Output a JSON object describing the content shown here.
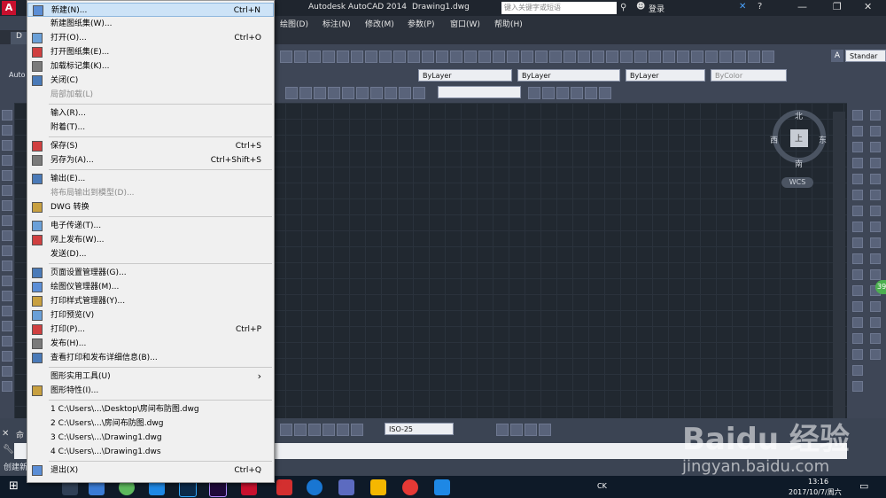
{
  "app": {
    "app_title": "Autodesk AutoCAD 2014",
    "document_title": "Drawing1.dwg",
    "search_placeholder": "键入关键字或短语",
    "login_label": "登录",
    "tab_label": "D",
    "ribbon_label": "Auto",
    "standard_label": "Standar"
  },
  "menubar": [
    "绘图(D)",
    "标注(N)",
    "修改(M)",
    "参数(P)",
    "窗口(W)",
    "帮助(H)"
  ],
  "properties": {
    "color": "ByLayer",
    "linetype": "ByLayer",
    "lineweight": "ByLayer",
    "plotstyle": "ByColor",
    "dimstyle": "ISO-25"
  },
  "viewcube": {
    "north": "北",
    "south": "南",
    "east": "东",
    "west": "西",
    "face": "上",
    "wcs": "WCS"
  },
  "file_menu": {
    "items": [
      {
        "label": "新建(N)...",
        "shortcut": "Ctrl+N",
        "icon": "new-file-icon",
        "highlighted": true
      },
      {
        "label": "新建图纸集(W)...",
        "shortcut": "",
        "icon": ""
      },
      {
        "label": "打开(O)...",
        "shortcut": "Ctrl+O",
        "icon": "open-folder-icon"
      },
      {
        "label": "打开图纸集(E)...",
        "shortcut": "",
        "icon": "sheet-set-icon"
      },
      {
        "label": "加载标记集(K)...",
        "shortcut": "",
        "icon": "markup-icon"
      },
      {
        "label": "关闭(C)",
        "shortcut": "",
        "icon": "close-doc-icon"
      },
      {
        "label": "局部加载(L)",
        "shortcut": "",
        "icon": "",
        "disabled": true
      },
      {
        "label": "输入(R)...",
        "shortcut": "",
        "icon": ""
      },
      {
        "label": "附着(T)...",
        "shortcut": "",
        "icon": ""
      },
      {
        "label": "保存(S)",
        "shortcut": "Ctrl+S",
        "icon": "save-icon"
      },
      {
        "label": "另存为(A)...",
        "shortcut": "Ctrl+Shift+S",
        "icon": "save-as-icon"
      },
      {
        "label": "输出(E)...",
        "shortcut": "",
        "icon": "export-icon"
      },
      {
        "label": "将布局输出到模型(D)...",
        "shortcut": "",
        "icon": "",
        "disabled": true
      },
      {
        "label": "DWG 转换",
        "shortcut": "",
        "icon": "dwg-convert-icon"
      },
      {
        "label": "电子传递(T)...",
        "shortcut": "",
        "icon": "etransmit-icon"
      },
      {
        "label": "网上发布(W)...",
        "shortcut": "",
        "icon": "publish-web-icon"
      },
      {
        "label": "发送(D)...",
        "shortcut": "",
        "icon": ""
      },
      {
        "label": "页面设置管理器(G)...",
        "shortcut": "",
        "icon": "page-setup-icon"
      },
      {
        "label": "绘图仪管理器(M)...",
        "shortcut": "",
        "icon": "plotter-icon"
      },
      {
        "label": "打印样式管理器(Y)...",
        "shortcut": "",
        "icon": "plot-style-icon"
      },
      {
        "label": "打印预览(V)",
        "shortcut": "",
        "icon": "preview-icon"
      },
      {
        "label": "打印(P)...",
        "shortcut": "Ctrl+P",
        "icon": "print-icon"
      },
      {
        "label": "发布(H)...",
        "shortcut": "",
        "icon": "publish-icon"
      },
      {
        "label": "查看打印和发布详细信息(B)...",
        "shortcut": "",
        "icon": "plot-details-icon"
      },
      {
        "label": "图形实用工具(U)",
        "shortcut": "",
        "icon": "",
        "submenu": true
      },
      {
        "label": "图形特性(I)...",
        "shortcut": "",
        "icon": "drawing-props-icon"
      },
      {
        "label": "1 C:\\Users\\...\\Desktop\\房间布防图.dwg",
        "shortcut": "",
        "icon": ""
      },
      {
        "label": "2 C:\\Users\\...\\房间布防图.dwg",
        "shortcut": "",
        "icon": ""
      },
      {
        "label": "3 C:\\Users\\...\\Drawing1.dwg",
        "shortcut": "",
        "icon": ""
      },
      {
        "label": "4 C:\\Users\\...\\Drawing1.dws",
        "shortcut": "",
        "icon": ""
      },
      {
        "label": "退出(X)",
        "shortcut": "Ctrl+Q",
        "icon": "exit-icon"
      }
    ]
  },
  "command": {
    "label": "命",
    "status": "创建新"
  },
  "taskbar": {
    "time": "13:16",
    "date": "2017/10/7/周六",
    "ime": "CK",
    "badge": "39"
  },
  "watermark": {
    "brand": "Baidu 经验",
    "url": "jingyan.baidu.com"
  },
  "colors": {
    "highlight": "#cde3f7",
    "canvas": "#212830",
    "autocad_red": "#c8102e"
  }
}
